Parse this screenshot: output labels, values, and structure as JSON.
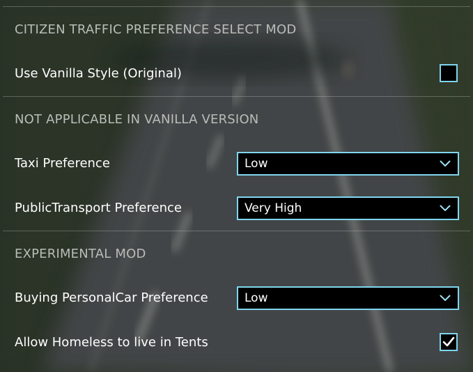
{
  "colors": {
    "accent_border": "#7fd6ef",
    "control_background": "#000000",
    "header_text": "#b9bdb8",
    "label_text": "#ffffff"
  },
  "sections": {
    "citizen_traffic": {
      "header": "CITIZEN TRAFFIC PREFERENCE SELECT MOD",
      "use_vanilla": {
        "label": "Use Vanilla Style (Original)",
        "checked": false
      }
    },
    "not_applicable": {
      "header": "NOT APPLICABLE IN VANILLA VERSION",
      "taxi": {
        "label": "Taxi Preference",
        "value": "Low",
        "icon": "chevron-down-icon"
      },
      "public_transport": {
        "label": "PublicTransport Preference",
        "value": "Very High",
        "icon": "chevron-down-icon"
      }
    },
    "experimental": {
      "header": "EXPERIMENTAL MOD",
      "buying_car": {
        "label": "Buying PersonalCar Preference",
        "value": "Low",
        "icon": "chevron-down-icon"
      },
      "homeless_tents": {
        "label": "Allow Homeless to live in Tents",
        "checked": true,
        "icon": "checkmark-icon"
      }
    }
  }
}
